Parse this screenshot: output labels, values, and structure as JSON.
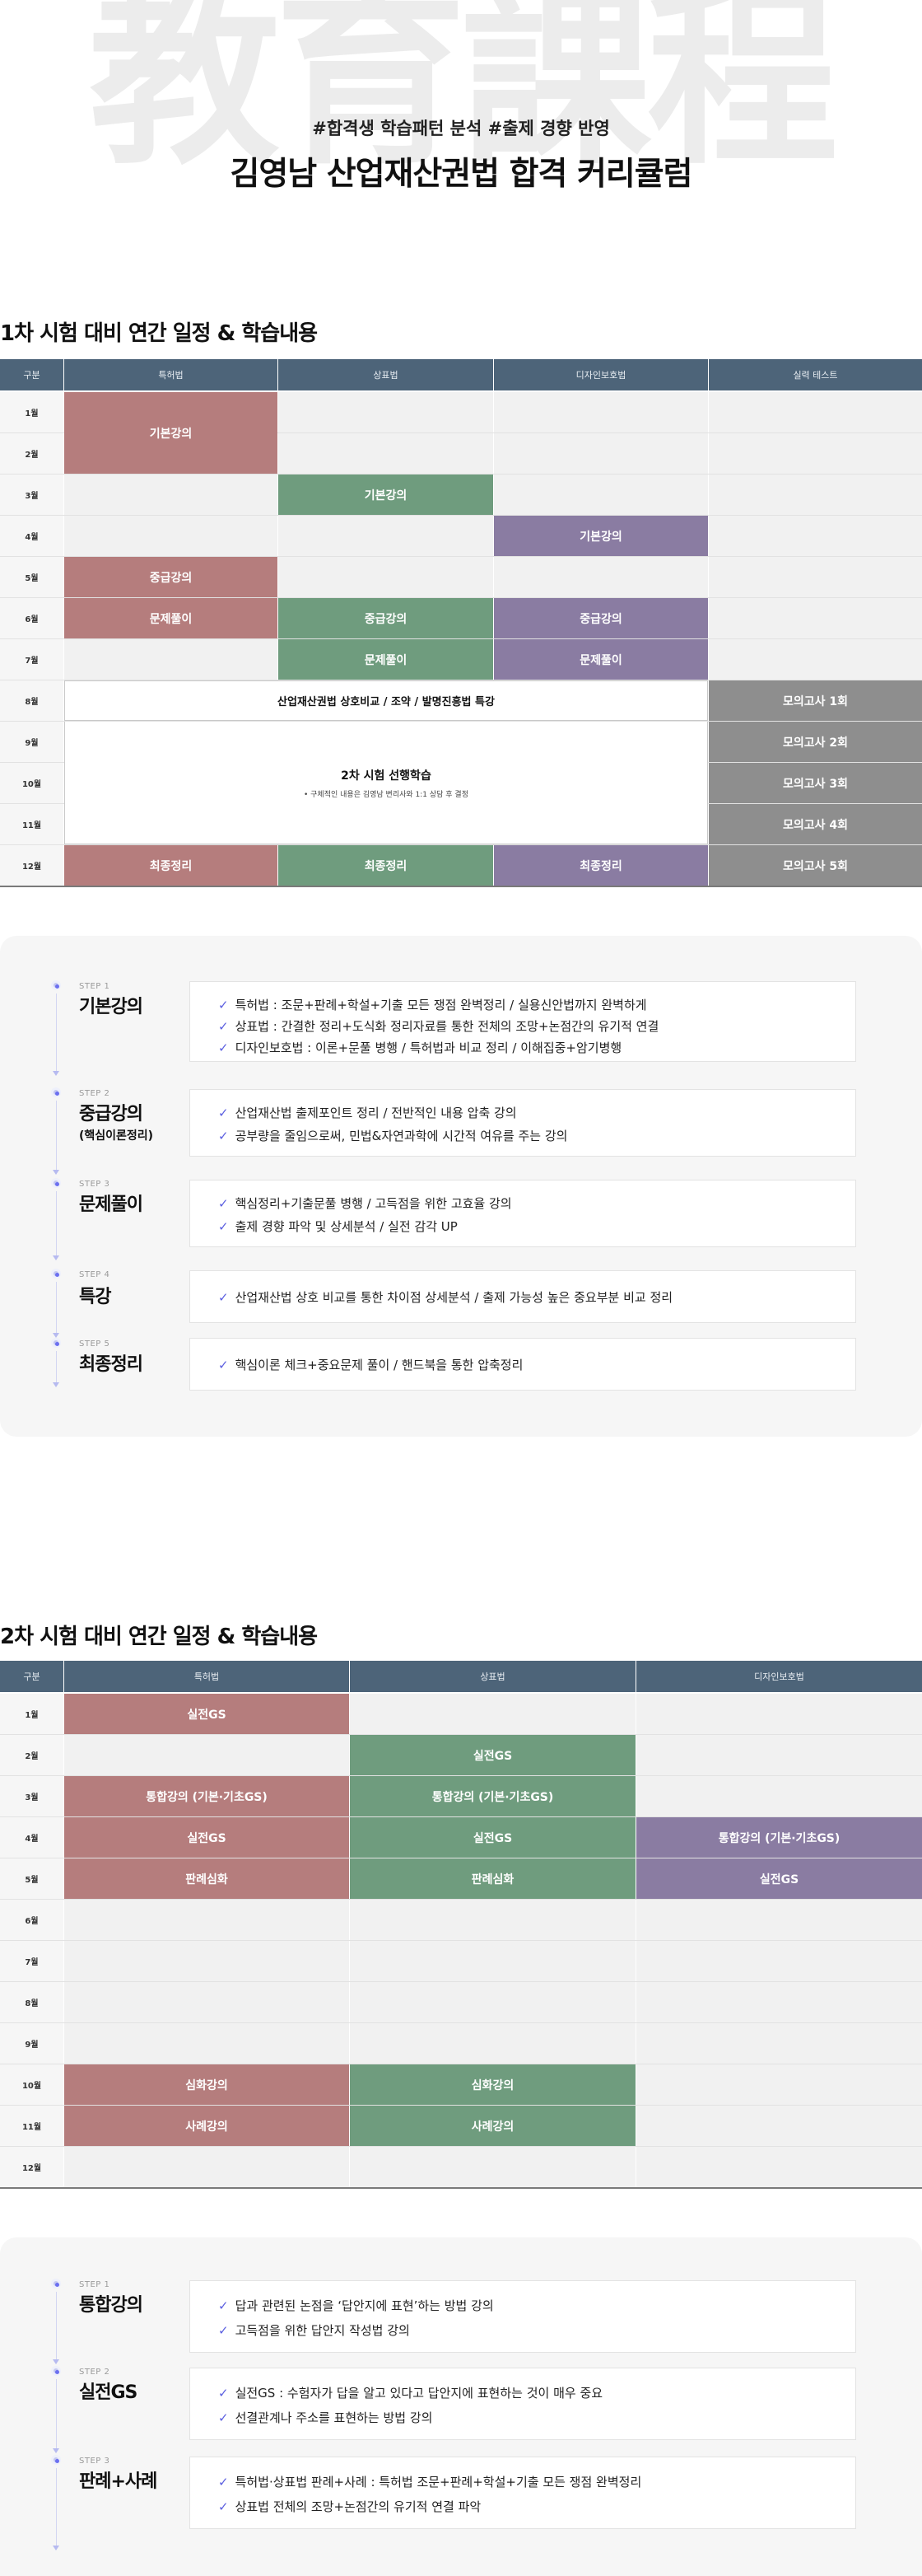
{
  "hero": {
    "background_text": "教育課程",
    "tags": "#합격생 학습패턴 분석 #출제 경향 반영",
    "title": "김영남 산업재산권법 합격 커리큘럼"
  },
  "colors": {
    "header": "#4d6479",
    "patent": "#b57d7d",
    "trademark": "#6f9c7e",
    "design": "#8a7ca2",
    "test": "#8e8e8e",
    "check": "#5b5fe0"
  },
  "exam1": {
    "title": "1차 시험 대비 연간 일정 & 학습내용",
    "headers": [
      "구분",
      "특허법",
      "상표법",
      "디자인보호법",
      "실력 테스트"
    ],
    "months": [
      "1월",
      "2월",
      "3월",
      "4월",
      "5월",
      "6월",
      "7월",
      "8월",
      "9월",
      "10월",
      "11월",
      "12월"
    ],
    "blocks": {
      "patent_basic": "기본강의",
      "trademark_basic": "기본강의",
      "design_basic": "기본강의",
      "patent_mid": "중급강의",
      "patent_practice": "문제풀이",
      "trademark_mid": "중급강의",
      "design_mid": "중급강의",
      "trademark_practice": "문제풀이",
      "design_practice": "문제풀이",
      "special": "산업재산권법 상호비교 / 조약 / 발명진흥법 특강",
      "second_prep": "2차 시험 선행학습",
      "second_prep_note": "• 구체적인 내용은 김영남 변리사와 1:1 상담 후 결정",
      "patent_final": "최종정리",
      "trademark_final": "최종정리",
      "design_final": "최종정리",
      "mock1": "모의고사 1회",
      "mock2": "모의고사 2회",
      "mock3": "모의고사 3회",
      "mock4": "모의고사 4회",
      "mock5": "모의고사 5회"
    }
  },
  "steps1": [
    {
      "no": "STEP 1",
      "name": "기본강의",
      "sub": "",
      "lines": [
        "특허법 : 조문+판례+학설+기출 모든 쟁점 완벽정리 / 실용신안법까지 완벽하게",
        "상표법 : 간결한 정리+도식화 정리자료를 통한 전체의 조망+논점간의 유기적 연결",
        "디자인보호법 : 이론+문풀 병행 / 특허법과 비교 정리 / 이해집중+암기병행"
      ]
    },
    {
      "no": "STEP 2",
      "name": "중급강의",
      "sub": "(핵심이론정리)",
      "lines": [
        "산업재산법 출제포인트 정리 / 전반적인 내용 압축 강의",
        "공부량을 줄임으로써, 민법&자연과학에 시간적 여유를 주는 강의"
      ]
    },
    {
      "no": "STEP 3",
      "name": "문제풀이",
      "sub": "",
      "lines": [
        "핵심정리+기출문풀 병행 / 고득점을 위한 고효율 강의",
        "출제 경향 파악 및 상세분석 / 실전 감각 UP"
      ]
    },
    {
      "no": "STEP 4",
      "name": "특강",
      "sub": "",
      "lines": [
        "산업재산법 상호 비교를 통한 차이점 상세분석 / 출제 가능성 높은 중요부분 비교 정리"
      ]
    },
    {
      "no": "STEP 5",
      "name": "최종정리",
      "sub": "",
      "lines": [
        "핵심이론 체크+중요문제 풀이 / 핸드북을 통한 압축정리"
      ]
    }
  ],
  "exam2": {
    "title": "2차 시험 대비 연간 일정 & 학습내용",
    "headers": [
      "구분",
      "특허법",
      "상표법",
      "디자인보호법"
    ],
    "months": [
      "1월",
      "2월",
      "3월",
      "4월",
      "5월",
      "6월",
      "7월",
      "8월",
      "9월",
      "10월",
      "11월",
      "12월"
    ],
    "blocks": {
      "patent_gs1": "실전GS",
      "trademark_gs2": "실전GS",
      "patent_integrated": "통합강의 (기본·기초GS)",
      "trademark_integrated": "통합강의 (기본·기초GS)",
      "patent_gs4": "실전GS",
      "trademark_gs4": "실전GS",
      "design_integrated": "통합강의 (기본·기초GS)",
      "patent_case": "판례심화",
      "trademark_case": "판례심화",
      "design_gs5": "실전GS",
      "patent_adv": "심화강의",
      "trademark_adv": "심화강의",
      "patent_example": "사례강의",
      "trademark_example": "사례강의"
    }
  },
  "steps2": [
    {
      "no": "STEP 1",
      "name": "통합강의",
      "lines": [
        "답과 관련된 논점을 ‘답안지에 표현’하는 방법 강의",
        "고득점을 위한 답안지 작성법 강의"
      ]
    },
    {
      "no": "STEP 2",
      "name": "실전GS",
      "lines": [
        "실전GS : 수험자가 답을 알고 있다고 답안지에 표현하는 것이 매우 중요",
        "선결관계나 주소를 표현하는 방법 강의"
      ]
    },
    {
      "no": "STEP 3",
      "name": "판례+사례",
      "lines": [
        "특허법·상표법 판례+사례 : 특허법 조문+판례+학설+기출 모든 쟁점 완벽정리",
        "상표법 전체의 조망+논점간의 유기적 연결 파악"
      ]
    }
  ]
}
